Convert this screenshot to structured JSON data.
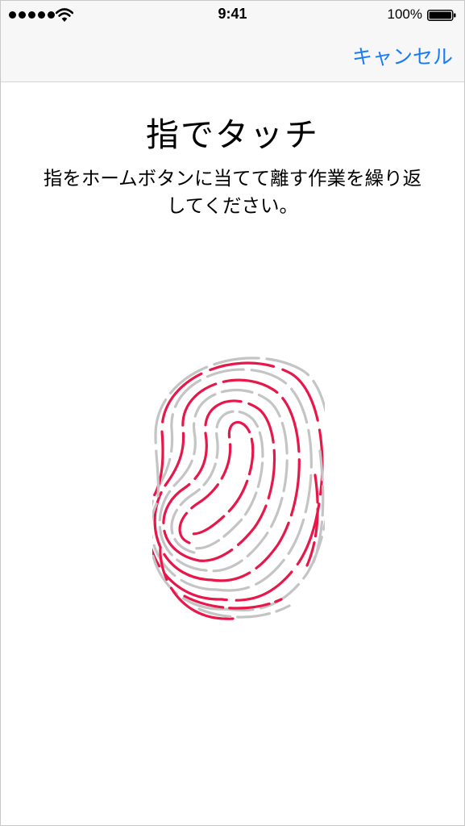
{
  "status_bar": {
    "time": "9:41",
    "battery_percent": "100%",
    "signal_dots": 5,
    "icons": [
      "signal-dots",
      "wifi-icon",
      "battery-icon"
    ]
  },
  "nav": {
    "cancel_label": "キャンセル"
  },
  "main": {
    "title": "指でタッチ",
    "instruction_line1": "指をホームボタンに当てて離す作業を繰り返",
    "instruction_line2": "してください。",
    "illustration": "fingerprint-icon"
  },
  "colors": {
    "accent": "#1a7cf5",
    "fingerprint_done": "#e8174a",
    "fingerprint_pending": "#c4c4c4",
    "nav_background": "#f7f7f7"
  }
}
